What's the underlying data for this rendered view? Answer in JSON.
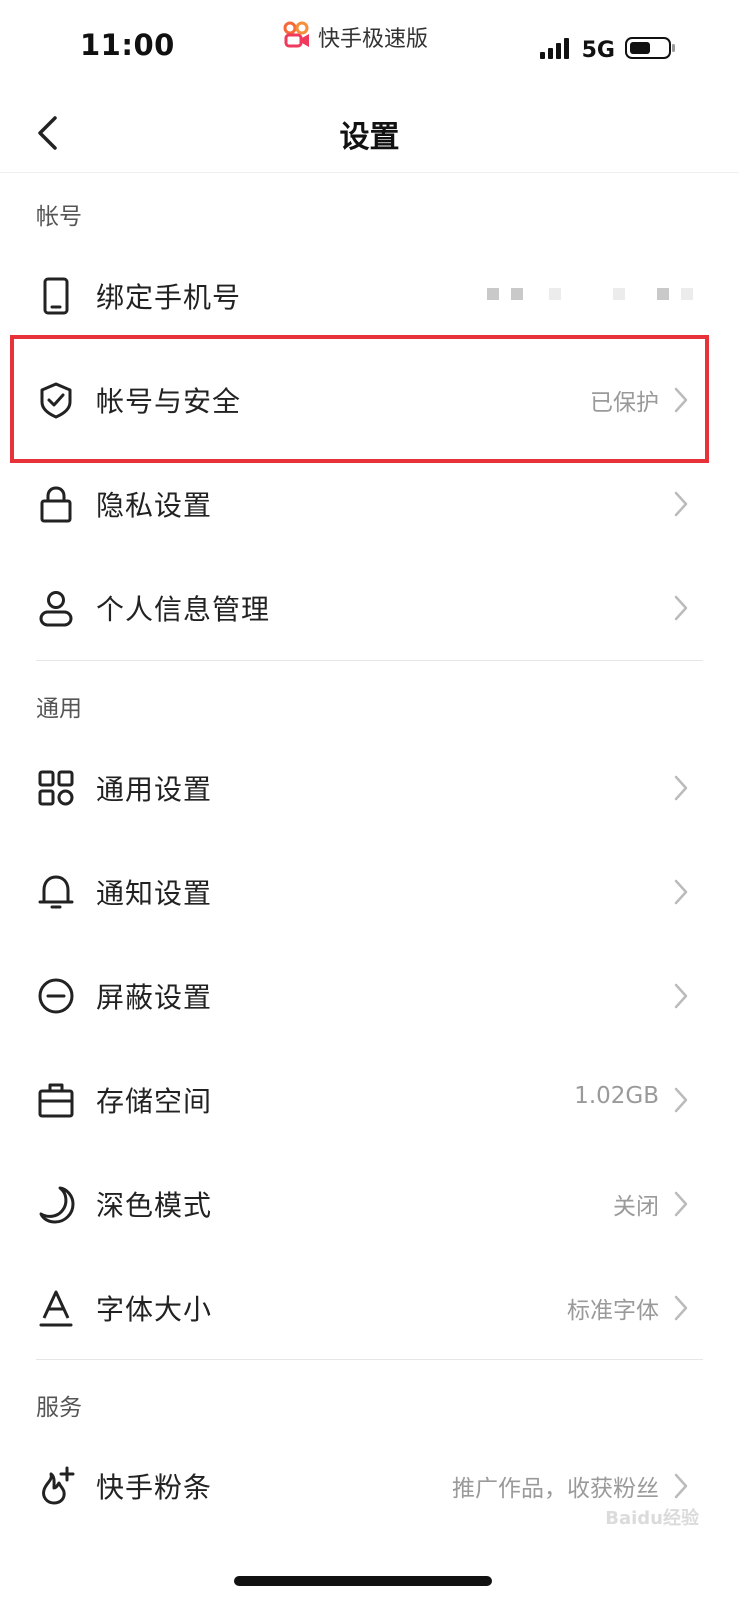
{
  "status_bar": {
    "time": "11:00",
    "app_name": "快手极速版",
    "network": "5G",
    "battery_level": 0.55
  },
  "nav": {
    "title": "设置"
  },
  "sections": {
    "account": {
      "header": "帐号",
      "items": [
        {
          "label": "绑定手机号",
          "icon": "phone-icon"
        },
        {
          "label": "帐号与安全",
          "value": "已保护",
          "icon": "shield-check-icon"
        },
        {
          "label": "隐私设置",
          "icon": "lock-icon"
        },
        {
          "label": "个人信息管理",
          "icon": "person-icon"
        }
      ]
    },
    "general": {
      "header": "通用",
      "items": [
        {
          "label": "通用设置",
          "icon": "grid-icon"
        },
        {
          "label": "通知设置",
          "icon": "bell-icon"
        },
        {
          "label": "屏蔽设置",
          "icon": "block-icon"
        },
        {
          "label": "存储空间",
          "value": "1.02GB",
          "icon": "storage-icon"
        },
        {
          "label": "深色模式",
          "value": "关闭",
          "icon": "moon-icon"
        },
        {
          "label": "字体大小",
          "value": "标准字体",
          "icon": "font-icon"
        }
      ]
    },
    "service": {
      "header": "服务",
      "items": [
        {
          "label": "快手粉条",
          "value": "推广作品，收获粉丝",
          "icon": "flame-plus-icon"
        }
      ]
    }
  },
  "watermark": "Baidu经验",
  "colors": {
    "highlight": "#e8323a",
    "muted_text": "#9a9a9a",
    "chevron": "#bbbbbb"
  }
}
